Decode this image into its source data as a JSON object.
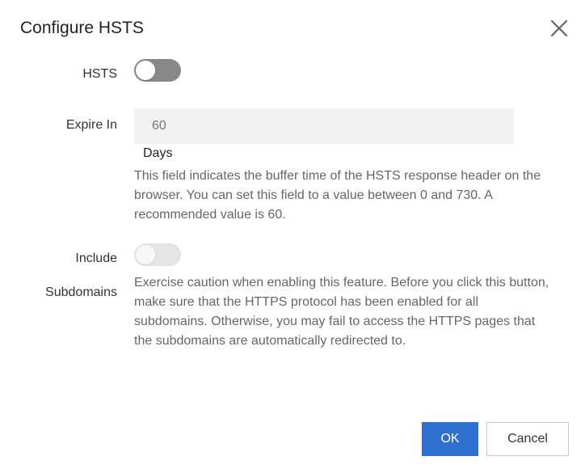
{
  "dialog": {
    "title": "Configure HSTS",
    "close_icon": "close-icon"
  },
  "hsts": {
    "label": "HSTS",
    "enabled": false
  },
  "expire": {
    "label": "Expire In",
    "placeholder": "60",
    "unit": "Days",
    "help": "This field indicates the buffer time of the HSTS response header on the browser. You can set this field to a value between 0 and 730. A recommended value is 60."
  },
  "subdomains": {
    "label_line1": "Include",
    "label_line2": "Subdomains",
    "enabled": false,
    "disabled": true,
    "help": "Exercise caution when enabling this feature. Before you click this button, make sure that the HTTPS protocol has been enabled for all subdomains. Otherwise, you may fail to access the HTTPS pages that the subdomains are automatically redirected to."
  },
  "buttons": {
    "ok_label": "OK",
    "cancel_label": "Cancel"
  },
  "colors": {
    "primary": "#2f6fd0",
    "toggle_off": "#888888",
    "toggle_disabled": "#e4e4e4"
  }
}
